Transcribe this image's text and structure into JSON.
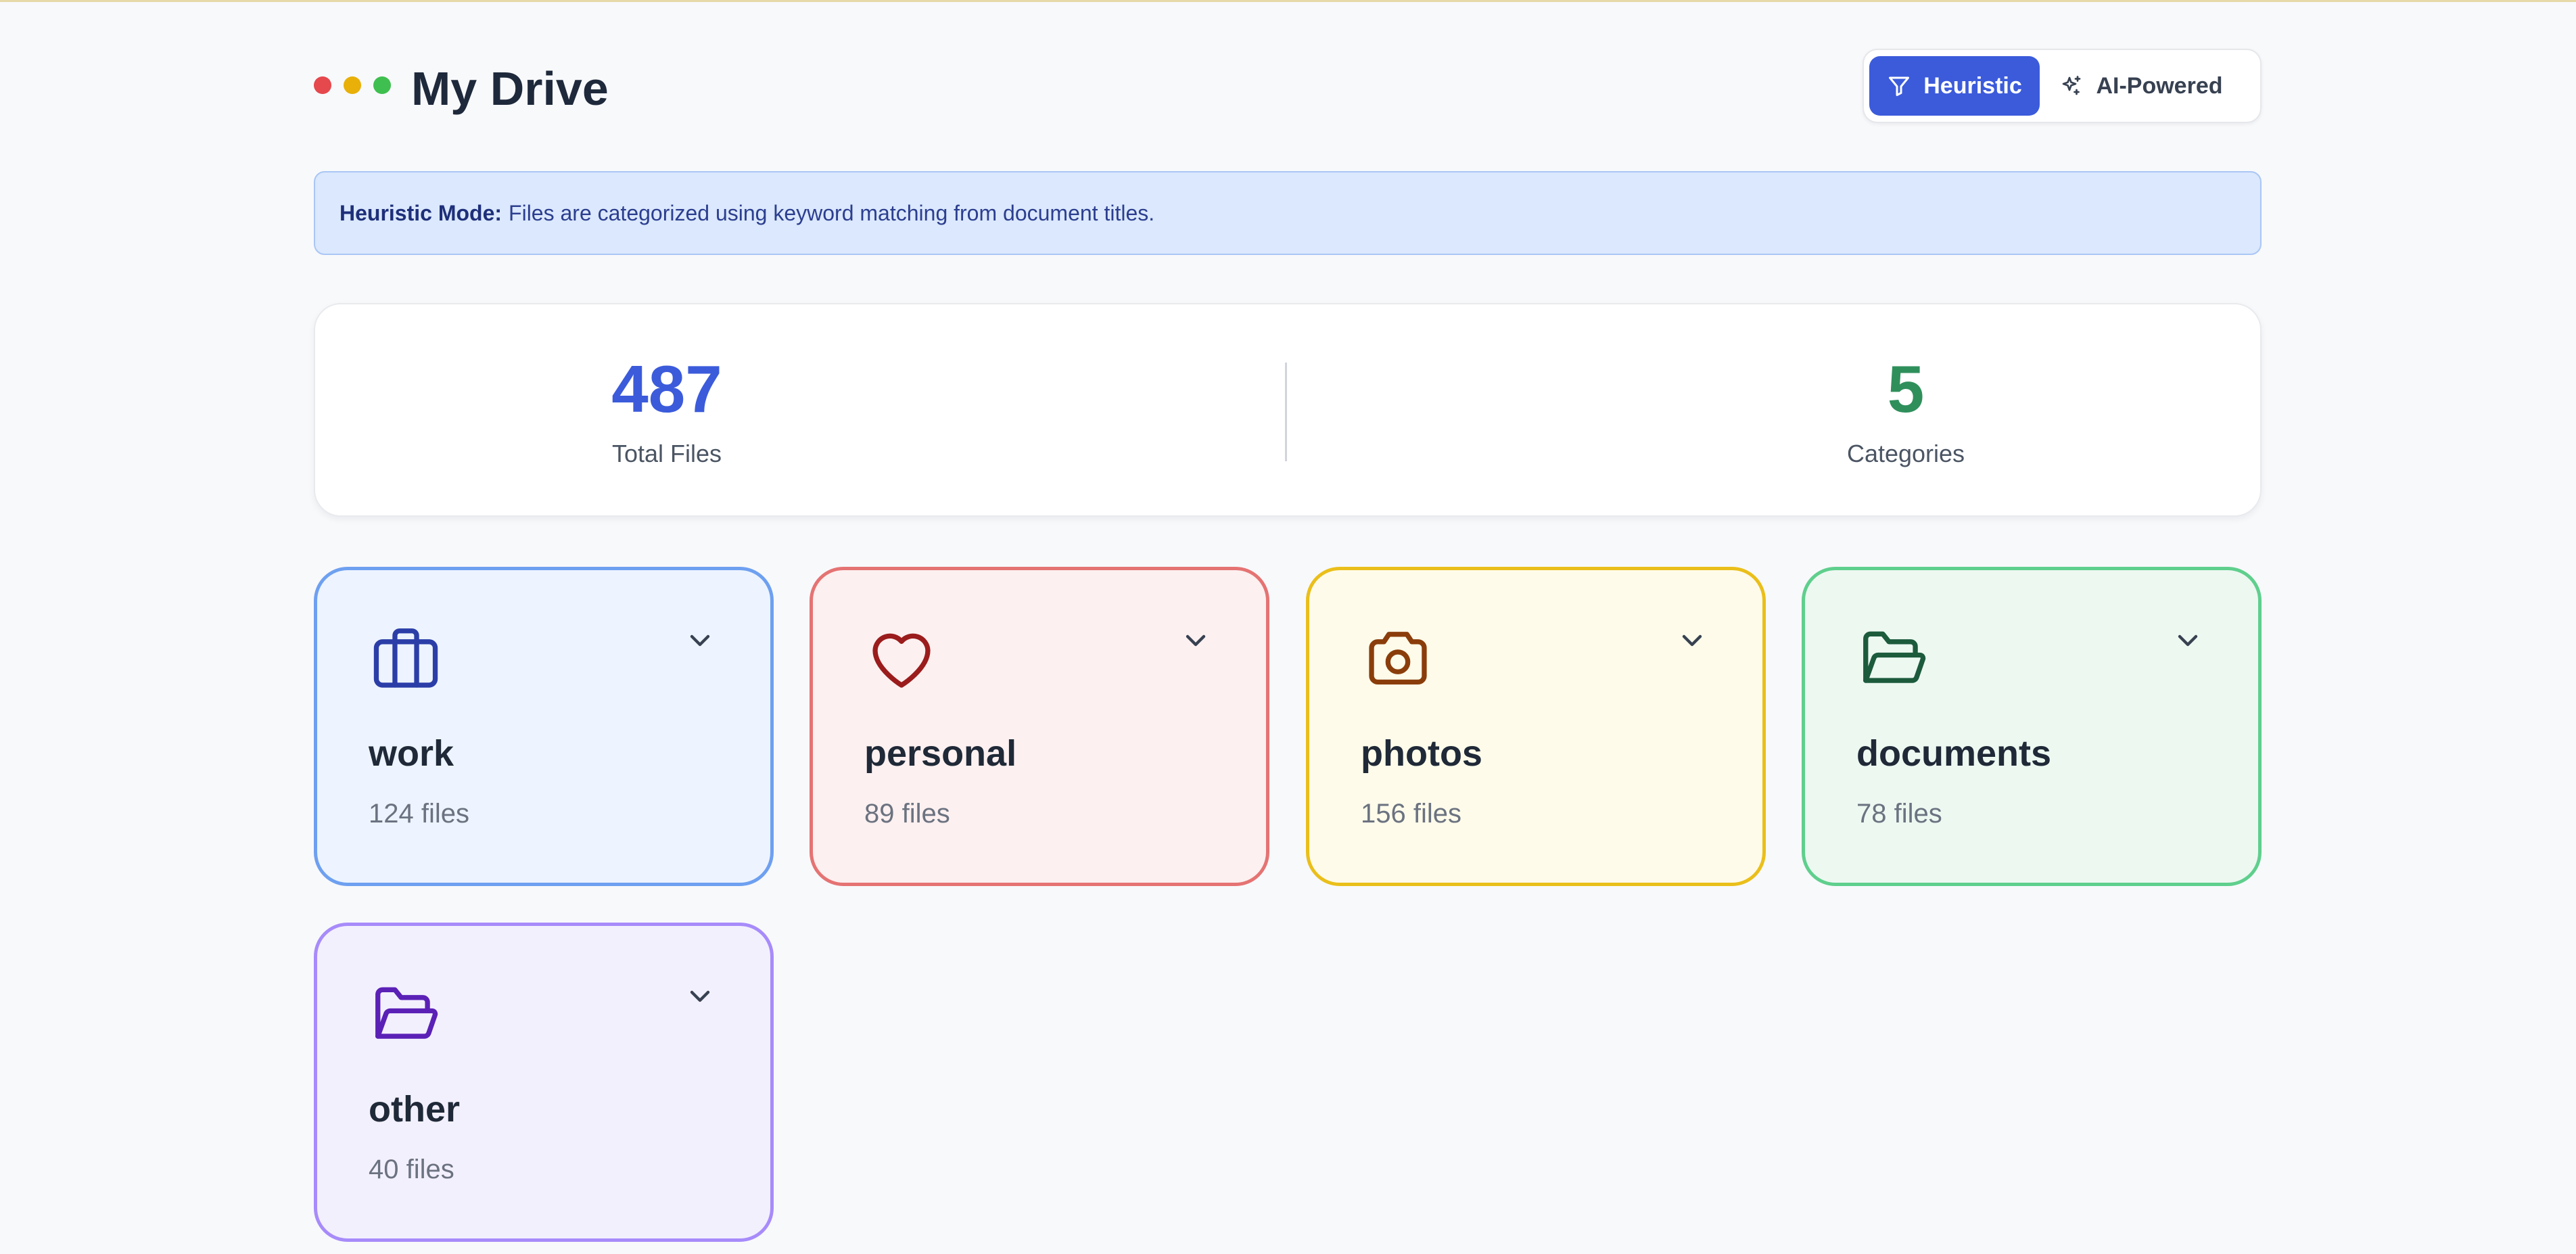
{
  "app": {
    "title": "My Drive",
    "window_dots": [
      "#e5484d",
      "#e8b008",
      "#3fbf4f"
    ]
  },
  "mode_toggle": {
    "options": [
      {
        "label": "Heuristic",
        "icon": "filter-icon",
        "active": true
      },
      {
        "label": "AI-Powered",
        "icon": "sparkles-icon",
        "active": false
      }
    ]
  },
  "banner": {
    "title": "Heuristic Mode:",
    "text": "Files are categorized using keyword matching from document titles."
  },
  "stats": [
    {
      "value": "487",
      "label": "Total Files",
      "color": "#3b5bdb"
    },
    {
      "value": "5",
      "label": "Categories",
      "color": "#2f8f5b"
    }
  ],
  "categories": [
    {
      "name": "work",
      "count": "124 files",
      "icon": "briefcase-icon",
      "border": "#6ea0f0",
      "bg": "#edf4ff",
      "icon_color": "#2b3ea8"
    },
    {
      "name": "personal",
      "count": "89 files",
      "icon": "heart-icon",
      "border": "#e57373",
      "bg": "#fcf0f0",
      "icon_color": "#9b1c1c"
    },
    {
      "name": "photos",
      "count": "156 files",
      "icon": "camera-icon",
      "border": "#eabf1a",
      "bg": "#fefbea",
      "icon_color": "#8a3d0a"
    },
    {
      "name": "documents",
      "count": "78 files",
      "icon": "folder-open-icon",
      "border": "#5fcf8d",
      "bg": "#edf8f1",
      "icon_color": "#1c5b3c"
    },
    {
      "name": "other",
      "count": "40 files",
      "icon": "folder-open-icon",
      "border": "#a78bfa",
      "bg": "#f3f0fe",
      "icon_color": "#5b21b6"
    }
  ]
}
